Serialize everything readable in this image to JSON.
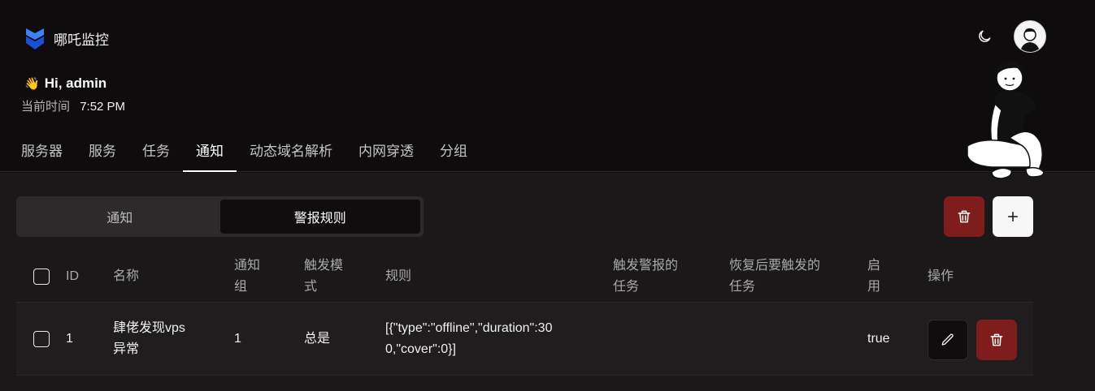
{
  "brand": {
    "name": "哪吒监控"
  },
  "greeting": {
    "wave": "👋",
    "text": "Hi, admin"
  },
  "time": {
    "label": "当前时间",
    "value": "7:52 PM"
  },
  "nav": {
    "items": [
      {
        "label": "服务器"
      },
      {
        "label": "服务"
      },
      {
        "label": "任务"
      },
      {
        "label": "通知",
        "active": true
      },
      {
        "label": "动态域名解析"
      },
      {
        "label": "内网穿透"
      },
      {
        "label": "分组"
      }
    ]
  },
  "segment": {
    "items": [
      {
        "label": "通知"
      },
      {
        "label": "警报规则",
        "active": true
      }
    ]
  },
  "table": {
    "headers": {
      "id": "ID",
      "name": "名称",
      "notify_group_1": "通知",
      "notify_group_2": "组",
      "trigger_mode_1": "触发模",
      "trigger_mode_2": "式",
      "rules": "规则",
      "alert_task_1": "触发警报的",
      "alert_task_2": "任务",
      "recover_task_1": "恢复后要触发的",
      "recover_task_2": "任务",
      "enabled_1": "启",
      "enabled_2": "用",
      "actions": "操作"
    },
    "rows": [
      {
        "id": "1",
        "name_1": "肆佬发现vps",
        "name_2": "异常",
        "notify_group": "1",
        "trigger_mode": "总是",
        "rules_1": "[{\"type\":\"offline\",\"duration\":30",
        "rules_2": "0,\"cover\":0}]",
        "alert_task": "",
        "recover_task": "",
        "enabled": "true"
      }
    ]
  },
  "colors": {
    "background": "#0e0c0d",
    "panel": "#1a1819",
    "danger": "#7f1d1d",
    "brand_blue": "#2563eb"
  }
}
